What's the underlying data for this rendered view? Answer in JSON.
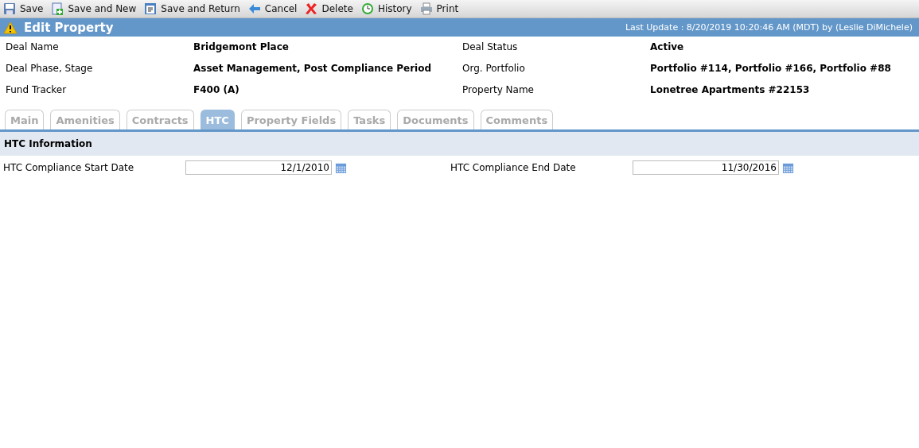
{
  "toolbar": [
    {
      "kind": "save",
      "label": "Save"
    },
    {
      "kind": "save-new",
      "label": "Save and New"
    },
    {
      "kind": "save-return",
      "label": "Save and Return"
    },
    {
      "kind": "cancel",
      "label": "Cancel"
    },
    {
      "kind": "delete",
      "label": "Delete"
    },
    {
      "kind": "history",
      "label": "History"
    },
    {
      "kind": "print",
      "label": "Print"
    }
  ],
  "header": {
    "title": "Edit Property",
    "last_update": "Last Update : 8/20/2019 10:20:46 AM (MDT) by (Leslie DiMichele)"
  },
  "details": [
    {
      "label": "Deal Name",
      "value": "Bridgemont Place"
    },
    {
      "label": "Deal Status",
      "value": "Active"
    },
    {
      "label": "Deal Phase, Stage",
      "value": "Asset Management, Post Compliance Period"
    },
    {
      "label": "Org. Portfolio",
      "value": "Portfolio #114, Portfolio #166, Portfolio #88"
    },
    {
      "label": "Fund Tracker",
      "value": "F400 (A)"
    },
    {
      "label": "Property Name",
      "value": "Lonetree Apartments #22153"
    }
  ],
  "tabs": [
    {
      "label": "Main",
      "selected": false
    },
    {
      "label": "Amenities",
      "selected": false
    },
    {
      "label": "Contracts",
      "selected": false
    },
    {
      "label": "HTC",
      "selected": true
    },
    {
      "label": "Property Fields",
      "selected": false
    },
    {
      "label": "Tasks",
      "selected": false
    },
    {
      "label": "Documents",
      "selected": false
    },
    {
      "label": "Comments",
      "selected": false
    }
  ],
  "section": {
    "title": "HTC Information",
    "fields": [
      {
        "label": "HTC Compliance Start Date",
        "value": "12/1/2010"
      },
      {
        "label": "HTC Compliance End Date",
        "value": "11/30/2016"
      }
    ]
  }
}
